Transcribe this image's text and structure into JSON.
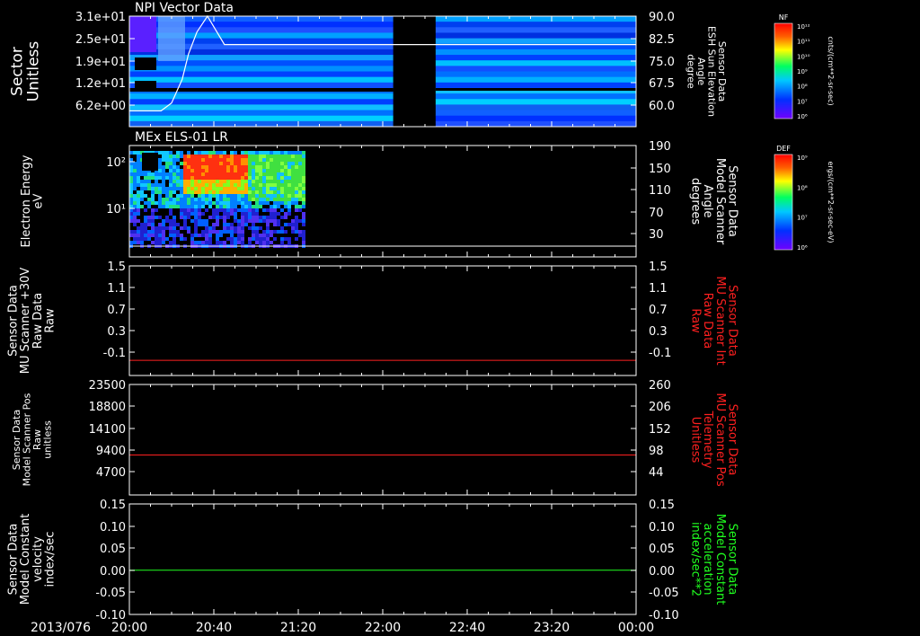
{
  "time_axis": {
    "start_label": "2013/076",
    "tick_labels": [
      "20:00",
      "20:40",
      "21:20",
      "22:00",
      "22:40",
      "23:20",
      "00:00"
    ]
  },
  "panels": [
    {
      "id": "npi",
      "title": "NPI Vector Data",
      "left_ylabel": [
        "Sector",
        "Unitless"
      ],
      "left_ticks": [
        "3.1e+01",
        "2.5e+01",
        "1.9e+01",
        "1.2e+01",
        "6.2e+00"
      ],
      "right_ylabel": [
        "Sensor Data",
        "ESH Sun Elevation",
        "Angle",
        "degree"
      ],
      "right_ticks": [
        "90.0",
        "82.5",
        "75.0",
        "67.5",
        "60.0"
      ],
      "colorbar": {
        "label": "NF",
        "units": "cnts/(cm**2-sr-sec)",
        "ticks": [
          "10¹²",
          "10¹¹",
          "10¹⁰",
          "10⁹",
          "10⁸",
          "10⁷",
          "10⁶"
        ]
      }
    },
    {
      "id": "els",
      "title": "MEx ELS-01 LR",
      "left_ylabel": [
        "Electron Energy",
        "eV"
      ],
      "left_ticks": [
        "10²",
        "10¹"
      ],
      "right_ylabel": [
        "Sensor Data",
        "Model Scanner",
        "Angle",
        "degrees"
      ],
      "right_ticks": [
        "190",
        "150",
        "110",
        "70",
        "30"
      ],
      "colorbar": {
        "label": "DEF",
        "units": "ergs/(cm**2-sr-sec-eV)",
        "ticks": [
          "10⁹",
          "10⁸",
          "10⁷",
          "10⁶"
        ]
      }
    },
    {
      "id": "mu_raw",
      "left_ylabel": [
        "Sensor Data",
        "MU Scanner +30V",
        "Raw Data",
        "Raw"
      ],
      "left_ticks": [
        "1.5",
        "1.1",
        "0.7",
        "0.3",
        "-0.1"
      ],
      "right_ylabel": [
        "Sensor Data",
        "MU Scanner Int",
        "Raw Data",
        "Raw"
      ],
      "right_ticks": [
        "1.5",
        "1.1",
        "0.7",
        "0.3",
        "-0.1"
      ],
      "right_color": "#ff2020",
      "line_color": "#ff2020"
    },
    {
      "id": "mu_pos",
      "left_ylabel": [
        "Sensor Data",
        "Model Scanner Pos",
        "Raw",
        "unitless"
      ],
      "left_ticks": [
        "23500",
        "18800",
        "14100",
        "9400",
        "4700"
      ],
      "right_ylabel": [
        "Sensor Data",
        "MU Scanner Pos",
        "Telemetry",
        "Unitless"
      ],
      "right_ticks": [
        "260",
        "206",
        "152",
        "98",
        "44"
      ],
      "right_color": "#ff2020",
      "line_color": "#ff2020"
    },
    {
      "id": "const",
      "left_ylabel": [
        "Sensor Data",
        "Model Constant",
        "velocity",
        "index/sec"
      ],
      "left_ticks": [
        "0.15",
        "0.10",
        "0.05",
        "0.00",
        "-0.05",
        "-0.10"
      ],
      "right_ylabel": [
        "Sensor Data",
        "Model Constant",
        "acceleration",
        "index/sec**2"
      ],
      "right_ticks": [
        "0.15",
        "0.10",
        "0.05",
        "0.00",
        "-0.05",
        "-0.10"
      ],
      "right_color": "#20ff20",
      "line_color": "#20ff20"
    }
  ],
  "chart_data": [
    {
      "type": "heatmap",
      "title": "NPI Vector Data",
      "x_range": [
        "20:00",
        "00:00"
      ],
      "ylabel": "Sector Unitless",
      "y_ticks": [
        31,
        25,
        19,
        12,
        6.2
      ],
      "data_gap": [
        "22:05",
        "22:25"
      ],
      "overlay_series": {
        "name": "ESH Sun Elevation Angle",
        "units": "degree",
        "ylim": [
          55,
          90
        ],
        "x": [
          "20:00",
          "20:15",
          "20:20",
          "20:25",
          "20:28",
          "20:32",
          "20:37",
          "20:45",
          "21:30",
          "23:00",
          "00:00"
        ],
        "y": [
          60.0,
          60.0,
          62.5,
          70.0,
          78.0,
          85.0,
          90.0,
          81.0,
          81.0,
          81.0,
          81.0
        ]
      }
    },
    {
      "type": "heatmap",
      "title": "MEx ELS-01 LR",
      "ylabel": "Electron Energy eV",
      "yscale": "log",
      "data_extent": [
        "20:00",
        "21:23"
      ],
      "intense_interval": [
        "20:25",
        "20:55"
      ],
      "overlay_series": {
        "name": "Model Scanner Angle",
        "units": "degrees",
        "ylim": [
          0,
          190
        ],
        "x": [
          "20:00",
          "00:00"
        ],
        "y": [
          0,
          0
        ]
      }
    },
    {
      "type": "line",
      "series": [
        {
          "name": "MU Scanner Int Raw Data",
          "x": [
            "20:00",
            "00:00"
          ],
          "y": [
            -0.05,
            -0.05
          ]
        }
      ],
      "ylim": [
        -0.3,
        1.5
      ]
    },
    {
      "type": "line",
      "series": [
        {
          "name": "MU Scanner Pos Telemetry",
          "x": [
            "20:00",
            "00:00"
          ],
          "y": [
            8500,
            8500
          ]
        }
      ],
      "ylim": [
        0,
        23500
      ]
    },
    {
      "type": "line",
      "series": [
        {
          "name": "Model Constant acceleration",
          "x": [
            "20:00",
            "00:00"
          ],
          "y": [
            0.0,
            0.0
          ]
        }
      ],
      "ylim": [
        -0.1,
        0.15
      ]
    }
  ]
}
